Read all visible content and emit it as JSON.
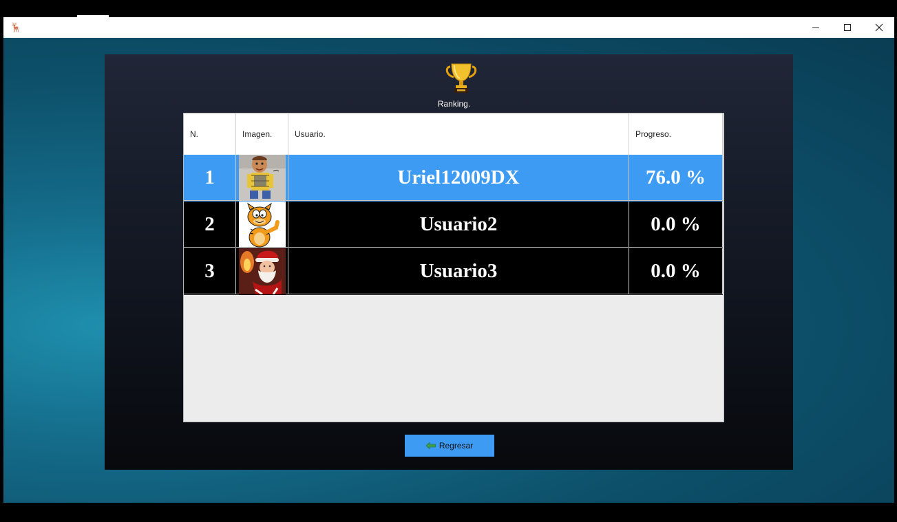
{
  "window": {
    "icon": "app-figure-icon",
    "controls": {
      "minimize": "minimize-icon",
      "maximize": "maximize-icon",
      "close": "close-icon"
    }
  },
  "ranking": {
    "title": "Ranking.",
    "icon": "trophy-icon",
    "columns": [
      "N.",
      "Imagen.",
      "Usuario.",
      "Progreso."
    ],
    "rows": [
      {
        "rank": "1",
        "avatar": "woody-avatar",
        "user": "Uriel12009DX",
        "progress": "76.0 %",
        "selected": true
      },
      {
        "rank": "2",
        "avatar": "garfield-avatar",
        "user": "Usuario2",
        "progress": "0.0 %",
        "selected": false
      },
      {
        "rank": "3",
        "avatar": "santa-avatar",
        "user": "Usuario3",
        "progress": "0.0 %",
        "selected": false
      }
    ]
  },
  "back_button": {
    "label": "Regresar",
    "icon": "back-arrow-icon"
  },
  "colors": {
    "selected_row": "#3d9bf4",
    "row": "#000000",
    "button": "#3d9bf4",
    "panel_top": "#212638",
    "panel_bottom": "#07090d"
  }
}
